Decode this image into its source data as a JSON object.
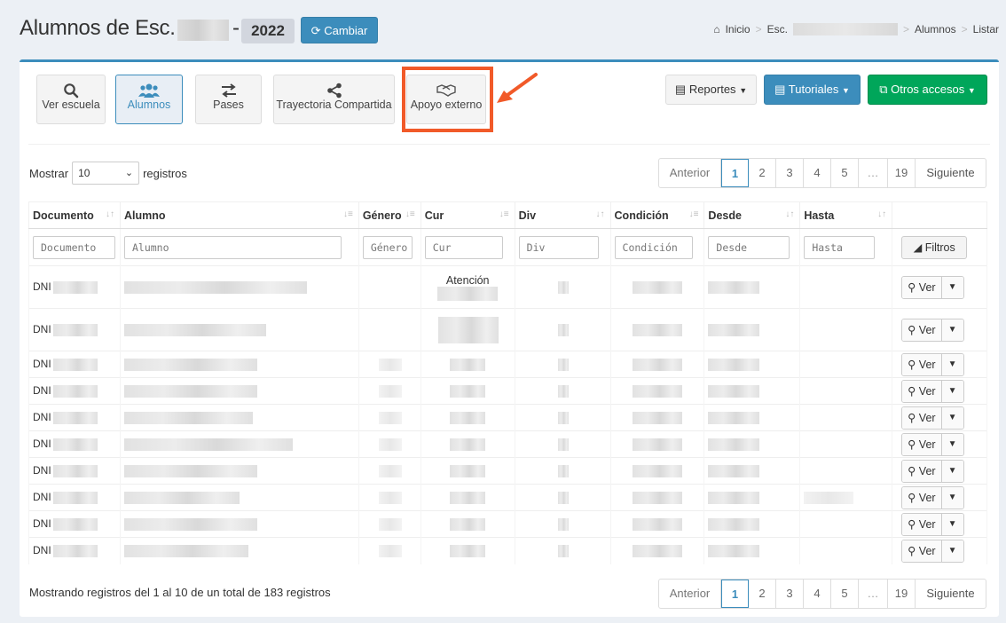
{
  "header": {
    "title_prefix": "Alumnos de Esc.",
    "title_dash": "-",
    "year": "2022",
    "cambiar_label": "Cambiar",
    "breadcrumb": {
      "home": "Inicio",
      "esc": "Esc.",
      "alumnos": "Alumnos",
      "listar": "Listar"
    }
  },
  "nav": [
    {
      "label": "Ver escuela",
      "icon": "search-icon"
    },
    {
      "label": "Alumnos",
      "icon": "users-icon",
      "active": true
    },
    {
      "label": "Pases",
      "icon": "exchange-icon"
    },
    {
      "label": "Trayectoria Compartida",
      "icon": "share-icon"
    },
    {
      "label": "Apoyo externo",
      "icon": "handshake-icon"
    }
  ],
  "menus": {
    "reportes": "Reportes",
    "tutoriales": "Tutoriales",
    "otros": "Otros accesos"
  },
  "length": {
    "prefix": "Mostrar",
    "value": "10",
    "suffix": "registros"
  },
  "pagination": {
    "anterior": "Anterior",
    "pages": [
      "1",
      "2",
      "3",
      "4",
      "5"
    ],
    "ellipsis": "…",
    "last": "19",
    "siguiente": "Siguiente",
    "current": "1"
  },
  "table": {
    "columns": [
      "Documento",
      "Alumno",
      "Género",
      "Cur",
      "Div",
      "Condición",
      "Desde",
      "Hasta"
    ],
    "filter_placeholders": [
      "Documento",
      "Alumno",
      "Género",
      "Cur",
      "Div",
      "Condición",
      "Desde",
      "Hasta"
    ],
    "filtros_label": "Filtros",
    "row_prefix": "DNI",
    "row_action": "Ver",
    "first_row_cur_text": "Atención",
    "row_count": 10
  },
  "footer": {
    "info": "Mostrando registros del 1 al 10 de un total de 183 registros"
  },
  "colors": {
    "primary": "#3c8dbc",
    "success": "#00a65a",
    "highlight": "#f15a29"
  }
}
